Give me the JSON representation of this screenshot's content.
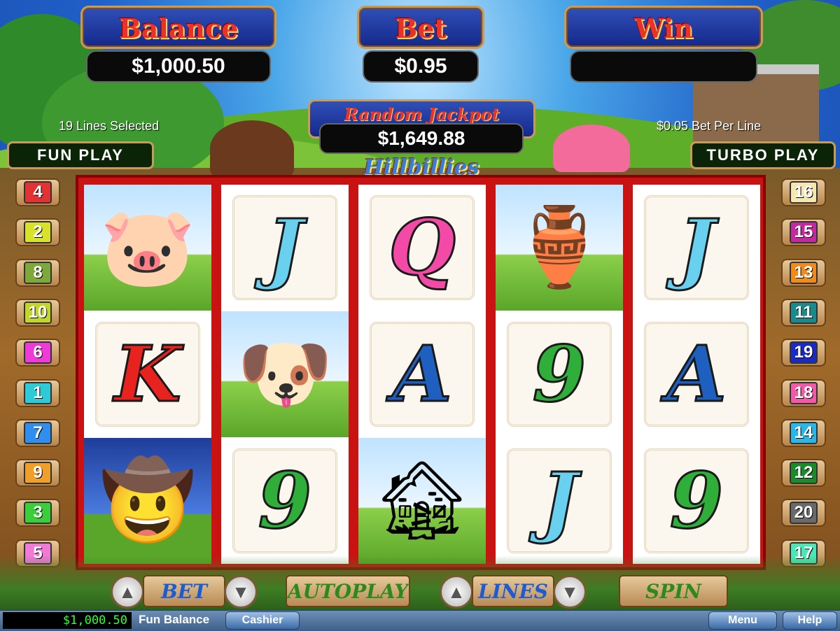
{
  "panels": {
    "balance": {
      "title": "Balance",
      "value": "$1,000.50"
    },
    "bet": {
      "title": "Bet",
      "value": "$0.95"
    },
    "win": {
      "title": "Win",
      "value": ""
    }
  },
  "jackpot": {
    "title": "Random Jackpot",
    "value": "$1,649.88"
  },
  "info": {
    "lines_selected": "19 Lines Selected",
    "bet_per_line": "$0.05 Bet Per Line"
  },
  "modes": {
    "fun_play": "FUN PLAY",
    "turbo_play": "TURBO PLAY"
  },
  "logo": "Hillbillies",
  "reels": [
    [
      {
        "symbol": "pig-in-barrel",
        "kind": "scene",
        "glyph": "🐷"
      },
      {
        "symbol": "K",
        "kind": "letter",
        "color": "#e8221f"
      },
      {
        "symbol": "hillbilly",
        "kind": "scene-dusk",
        "glyph": "🤠"
      }
    ],
    [
      {
        "symbol": "J",
        "kind": "letter",
        "color": "#6ad0f0"
      },
      {
        "symbol": "hound-dog",
        "kind": "scene",
        "glyph": "🐶"
      },
      {
        "symbol": "9",
        "kind": "letter",
        "color": "#2fae3a"
      }
    ],
    [
      {
        "symbol": "Q",
        "kind": "letter",
        "color": "#f24aa6"
      },
      {
        "symbol": "A",
        "kind": "letter",
        "color": "#1f5fbf"
      },
      {
        "symbol": "shack",
        "kind": "scene",
        "glyph": "🏚"
      }
    ],
    [
      {
        "symbol": "moonshine-jug",
        "kind": "scene",
        "glyph": "🏺"
      },
      {
        "symbol": "9",
        "kind": "letter",
        "color": "#2fae3a"
      },
      {
        "symbol": "J",
        "kind": "letter",
        "color": "#6ad0f0"
      }
    ],
    [
      {
        "symbol": "J",
        "kind": "letter",
        "color": "#6ad0f0"
      },
      {
        "symbol": "A",
        "kind": "letter",
        "color": "#1f5fbf"
      },
      {
        "symbol": "9",
        "kind": "letter",
        "color": "#2fae3a"
      }
    ]
  ],
  "left_lines": [
    {
      "n": "4",
      "color": "#e33232"
    },
    {
      "n": "2",
      "color": "#d8e22a"
    },
    {
      "n": "8",
      "color": "#7fa83a"
    },
    {
      "n": "10",
      "color": "#c2d62a"
    },
    {
      "n": "6",
      "color": "#ee3ad6"
    },
    {
      "n": "1",
      "color": "#2fcad6"
    },
    {
      "n": "7",
      "color": "#2f8ef0"
    },
    {
      "n": "9",
      "color": "#f0a02a"
    },
    {
      "n": "3",
      "color": "#3ace3a"
    },
    {
      "n": "5",
      "color": "#f07ad6"
    }
  ],
  "right_lines": [
    {
      "n": "16",
      "color": "#f6e6b0"
    },
    {
      "n": "15",
      "color": "#c22a9e"
    },
    {
      "n": "13",
      "color": "#f08a1a"
    },
    {
      "n": "11",
      "color": "#1a8a8a"
    },
    {
      "n": "19",
      "color": "#1a2ac2"
    },
    {
      "n": "18",
      "color": "#f05aa6"
    },
    {
      "n": "14",
      "color": "#2ab6e6"
    },
    {
      "n": "12",
      "color": "#1a8a2a"
    },
    {
      "n": "20",
      "color": "#6a6a6a"
    },
    {
      "n": "17",
      "color": "#4ae6b6"
    }
  ],
  "controls": {
    "bet": "BET",
    "autoplay": "AUTOPLAY",
    "lines": "LINES",
    "spin": "SPIN"
  },
  "statusbar": {
    "balance": "$1,000.50",
    "label": "Fun Balance",
    "cashier": "Cashier",
    "menu": "Menu",
    "help": "Help"
  }
}
